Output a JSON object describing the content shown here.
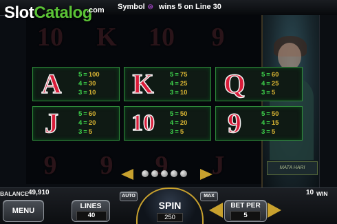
{
  "watermark": {
    "part1": "Slot",
    "part2": "Catalog",
    "part3": ".com"
  },
  "message": {
    "prefix": "Symbol",
    "symbol_glyph": "♾",
    "suffix": "wins 5 on Line 30"
  },
  "reels": {
    "row1": [
      "10",
      "K",
      "10",
      "9"
    ],
    "row3": [
      "9",
      "9",
      "9",
      "J"
    ]
  },
  "artwork": {
    "plaque": "MATA HARI"
  },
  "paytable": [
    {
      "symbol": "A",
      "pays": [
        {
          "count": "5",
          "value": "100"
        },
        {
          "count": "4",
          "value": "30"
        },
        {
          "count": "3",
          "value": "10"
        }
      ]
    },
    {
      "symbol": "K",
      "pays": [
        {
          "count": "5",
          "value": "75"
        },
        {
          "count": "4",
          "value": "25"
        },
        {
          "count": "3",
          "value": "10"
        }
      ]
    },
    {
      "symbol": "Q",
      "pays": [
        {
          "count": "5",
          "value": "60"
        },
        {
          "count": "4",
          "value": "25"
        },
        {
          "count": "3",
          "value": "5"
        }
      ]
    },
    {
      "symbol": "J",
      "pays": [
        {
          "count": "5",
          "value": "60"
        },
        {
          "count": "4",
          "value": "20"
        },
        {
          "count": "3",
          "value": "5"
        }
      ]
    },
    {
      "symbol": "10",
      "pays": [
        {
          "count": "5",
          "value": "50"
        },
        {
          "count": "4",
          "value": "20"
        },
        {
          "count": "3",
          "value": "5"
        }
      ]
    },
    {
      "symbol": "9",
      "pays": [
        {
          "count": "5",
          "value": "50"
        },
        {
          "count": "4",
          "value": "15"
        },
        {
          "count": "3",
          "value": "5"
        }
      ]
    }
  ],
  "pager": {
    "pages": 5
  },
  "balance": {
    "label": "BALANCE",
    "value": "49,910"
  },
  "wins": {
    "value": "10",
    "label": "WIN"
  },
  "buttons": {
    "menu": "MENU",
    "lines_label": "LINES",
    "lines_value": "40",
    "auto": "AUTO",
    "max": "MAX",
    "spin": "SPIN",
    "spin_value": "250",
    "bet_label": "BET PER",
    "bet_value": "5"
  },
  "colors": {
    "accent_gold": "#c8a12e",
    "paytable_border": "#2f8a3a",
    "symbol_red": "#d91c39",
    "pay_green": "#3fd84d",
    "pay_gold": "#d9b533"
  }
}
